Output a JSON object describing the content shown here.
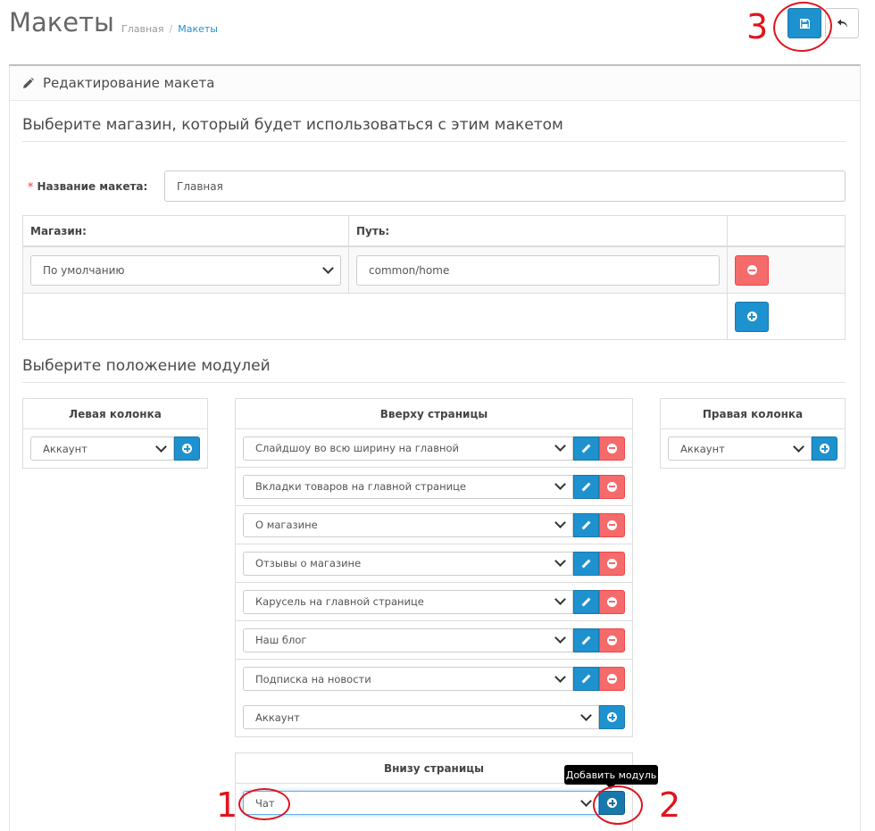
{
  "header": {
    "title": "Макеты",
    "breadcrumb": [
      {
        "label": "Главная"
      },
      {
        "label": "Макеты"
      }
    ],
    "save_icon": "floppy-disk-icon",
    "back_icon": "reply-arrow-icon"
  },
  "panel": {
    "heading": "Редактирование макета",
    "heading_icon": "pencil-icon"
  },
  "store_section": {
    "legend": "Выберите магазин, который будет использоваться с этим макетом",
    "name_label": "Название макета:",
    "required_mark": "*",
    "name_value": "Главная",
    "table": {
      "headers": [
        "Магазин:",
        "Путь:",
        ""
      ],
      "rows": [
        {
          "store": "По умолчанию",
          "path": "common/home"
        }
      ]
    }
  },
  "modules_section": {
    "legend": "Выберите положение модулей",
    "left_column": {
      "title": "Левая колонка",
      "add_select": "Аккаунт"
    },
    "top": {
      "title": "Вверху страницы",
      "modules": [
        "Слайдшоу во всю ширину на главной",
        "Вкладки товаров на главной странице",
        "О магазине",
        "Отзывы о магазине",
        "Карусель на главной странице",
        "Наш блог",
        "Подписка на новости"
      ],
      "add_select": "Аккаунт"
    },
    "right_column": {
      "title": "Правая колонка",
      "add_select": "Аккаунт"
    },
    "bottom": {
      "title": "Внизу страницы",
      "add_select": "Чат"
    }
  },
  "tooltip": "Добавить модуль",
  "annotations": [
    "1",
    "2",
    "3"
  ],
  "colors": {
    "primary": "#1e91cf",
    "danger": "#f56b6b",
    "annotation": "#e0141e"
  }
}
